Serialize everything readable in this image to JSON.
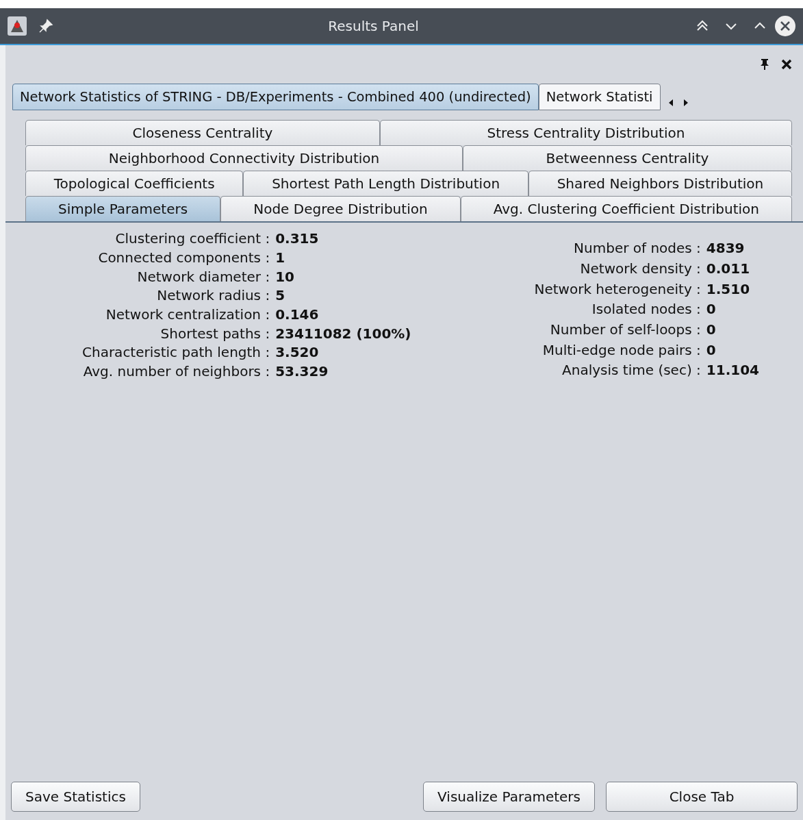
{
  "window": {
    "title": "Results Panel"
  },
  "network_tabs": [
    {
      "label": "Network Statistics of STRING - DB/Experiments - Combined 400 (undirected)",
      "selected": true
    },
    {
      "label": "Network Statisti",
      "selected": false
    }
  ],
  "analysis_tabs": [
    [
      {
        "label": "Closeness Centrality",
        "selected": false
      },
      {
        "label": "Stress Centrality Distribution",
        "selected": false
      }
    ],
    [
      {
        "label": "Neighborhood Connectivity Distribution",
        "selected": false
      },
      {
        "label": "Betweenness Centrality",
        "selected": false
      }
    ],
    [
      {
        "label": "Topological Coefficients",
        "selected": false
      },
      {
        "label": "Shortest Path Length Distribution",
        "selected": false
      },
      {
        "label": "Shared Neighbors Distribution",
        "selected": false
      }
    ],
    [
      {
        "label": "Simple Parameters",
        "selected": true
      },
      {
        "label": "Node Degree Distribution",
        "selected": false
      },
      {
        "label": "Avg. Clustering Coefficient Distribution",
        "selected": false
      }
    ]
  ],
  "parameters_left": [
    {
      "label": "Clustering coefficient :",
      "value": "0.315"
    },
    {
      "label": "Connected components :",
      "value": "1"
    },
    {
      "label": "Network diameter :",
      "value": "10"
    },
    {
      "label": "Network radius :",
      "value": "5"
    },
    {
      "label": "Network centralization :",
      "value": "0.146"
    },
    {
      "label": "Shortest paths :",
      "value": "23411082 (100%)"
    },
    {
      "label": "Characteristic path length :",
      "value": "3.520"
    },
    {
      "label": "Avg. number of neighbors :",
      "value": "53.329"
    }
  ],
  "parameters_right": [
    {
      "label": "Number of nodes :",
      "value": "4839"
    },
    {
      "label": "Network density :",
      "value": "0.011"
    },
    {
      "label": "Network heterogeneity :",
      "value": "1.510"
    },
    {
      "label": "Isolated nodes :",
      "value": "0"
    },
    {
      "label": "Number of self-loops :",
      "value": "0"
    },
    {
      "label": "Multi-edge node pairs :",
      "value": "0"
    },
    {
      "label": "Analysis time (sec) :",
      "value": "11.104"
    }
  ],
  "buttons": [
    "Save Statistics",
    "Visualize Parameters",
    "Close Tab"
  ]
}
